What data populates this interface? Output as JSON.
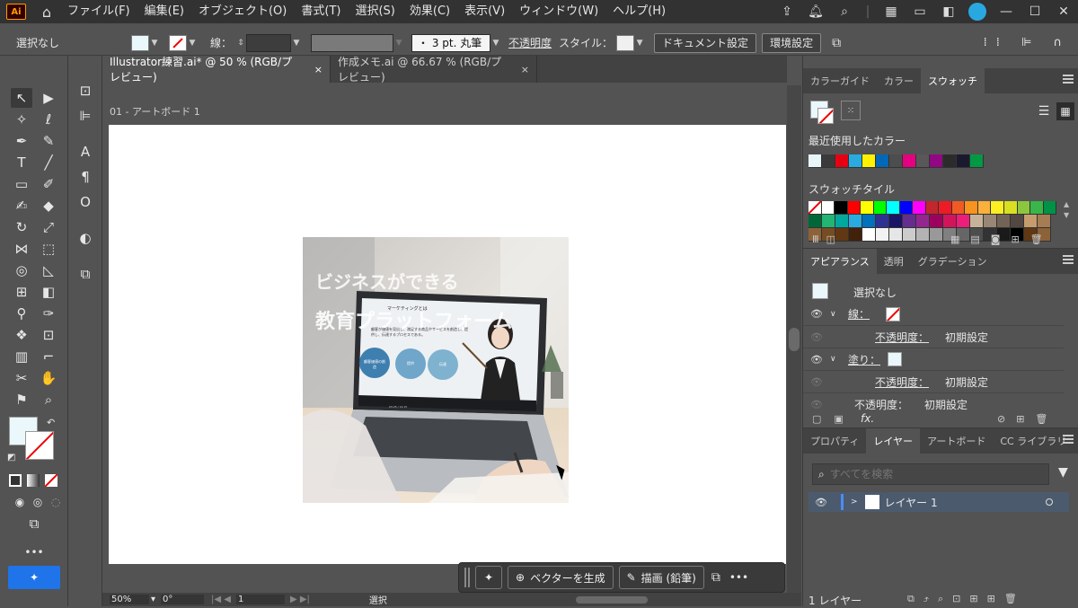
{
  "menu": {
    "logo": "Ai",
    "items": [
      "ファイル(F)",
      "編集(E)",
      "オブジェクト(O)",
      "書式(T)",
      "選択(S)",
      "効果(C)",
      "表示(V)",
      "ウィンドウ(W)",
      "ヘルプ(H)"
    ]
  },
  "control": {
    "selection": "選択なし",
    "stroke_label": "線：",
    "brush": "・ 3 pt. 丸筆",
    "opacity_label": "不透明度",
    "style_label": "スタイル：",
    "doc_settings": "ドキュメント設定",
    "prefs": "環境設定"
  },
  "tabs": [
    {
      "label": "Illustrator練習.ai* @ 50 % (RGB/プレビュー)",
      "close": "×"
    },
    {
      "label": "作成メモ.ai @ 66.67 % (RGB/プレビュー)",
      "close": "×"
    }
  ],
  "artboard": {
    "label": "01 - アートボード 1"
  },
  "photo": {
    "headline1": "ビジネスができる",
    "headline2": "教育プラットフォーム",
    "slide_title1": "マーケティングとは",
    "slide_title2": "マーケティングとは",
    "slide_body": "顧客が価値を見出し、満足する商品やサービスを創造し、提供し、伝達するプロセスである。",
    "circle1": "顧客価値の創造",
    "circle2": "提供",
    "circle3": "伝達",
    "time": "03:25 / 12:15"
  },
  "context_bar": {
    "vector": "ベクターを生成",
    "draw": "描画 (鉛筆)",
    "more": "•••"
  },
  "status": {
    "zoom": "50%",
    "angle": "0°",
    "page": "1",
    "tool": "選択"
  },
  "color_panel": {
    "tabs": [
      "カラーガイド",
      "カラー",
      "スウォッチ"
    ],
    "recent_label": "最近使用したカラー",
    "tile_label": "スウォッチタイル",
    "recent_colors": [
      "#e8f6f9",
      "#3a3a3a",
      "#e60012",
      "#29abe2",
      "#fff100",
      "#0068b7",
      "#4d4d4d",
      "#e4007f",
      "#595757",
      "#920783",
      "#2b2b2b",
      "#1a1a2e",
      "#009944"
    ],
    "tiles_row1": [
      "#ffffff",
      "#000000",
      "#ff0000",
      "#ffff00",
      "#00ff00",
      "#00ffff",
      "#0000ff",
      "#ff00ff",
      "#c1272d",
      "#ed1c24",
      "#f15a24",
      "#f7931e",
      "#fbb03b",
      "#fcee21",
      "#d9e021",
      "#8cc63f",
      "#39b54a",
      "#009245"
    ],
    "tiles_row2": [
      "#006837",
      "#22b573",
      "#00a99d",
      "#29abe2",
      "#0071bc",
      "#2e3192",
      "#1b1464",
      "#662d91",
      "#93278f",
      "#9e005d",
      "#d4145a",
      "#ed1e79",
      "#c7b299",
      "#998675",
      "#736357",
      "#534741",
      "#c69c6d",
      "#a67c52"
    ],
    "tiles_row3": [
      "#8c6239",
      "#754c24",
      "#603813",
      "#42210b",
      "#ffffff",
      "#f2f2f2",
      "#e6e6e6",
      "#cccccc",
      "#b3b3b3",
      "#999999",
      "#808080",
      "#666666",
      "#4d4d4d",
      "#333333",
      "#1a1a1a",
      "#000000",
      "#603813",
      "#8c6239"
    ]
  },
  "appearance_panel": {
    "tabs": [
      "アピアランス",
      "透明",
      "グラデーション"
    ],
    "title": "選択なし",
    "stroke_label": "線：",
    "fill_label": "塗り：",
    "opacity_row1": "不透明度：",
    "opacity_val1": "初期設定",
    "opacity_row2": "不透明度：",
    "opacity_val2": "初期設定",
    "opacity_row3": "不透明度：",
    "opacity_val3": "初期設定",
    "fx": "fx."
  },
  "layers_panel": {
    "tabs": [
      "プロパティ",
      "レイヤー",
      "アートボード",
      "CC ライブラリ"
    ],
    "search_placeholder": "すべてを検索",
    "layer_name": "レイヤー 1",
    "footer": "1 レイヤー"
  }
}
